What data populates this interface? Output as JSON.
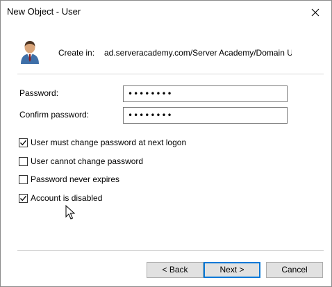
{
  "window": {
    "title": "New Object - User"
  },
  "header": {
    "create_in_label": "Create in:",
    "create_in_value": "ad.serveracademy.com/Server Academy/Domain U",
    "icon": "user-icon"
  },
  "form": {
    "password_label": "Password:",
    "password_value": "••••••••",
    "confirm_label": "Confirm password:",
    "confirm_value": "••••••••"
  },
  "options": [
    {
      "label": "User must change password at next logon",
      "checked": true
    },
    {
      "label": "User cannot change password",
      "checked": false
    },
    {
      "label": "Password never expires",
      "checked": false
    },
    {
      "label": "Account is disabled",
      "checked": true
    }
  ],
  "buttons": {
    "back": "< Back",
    "next": "Next >",
    "cancel": "Cancel"
  }
}
